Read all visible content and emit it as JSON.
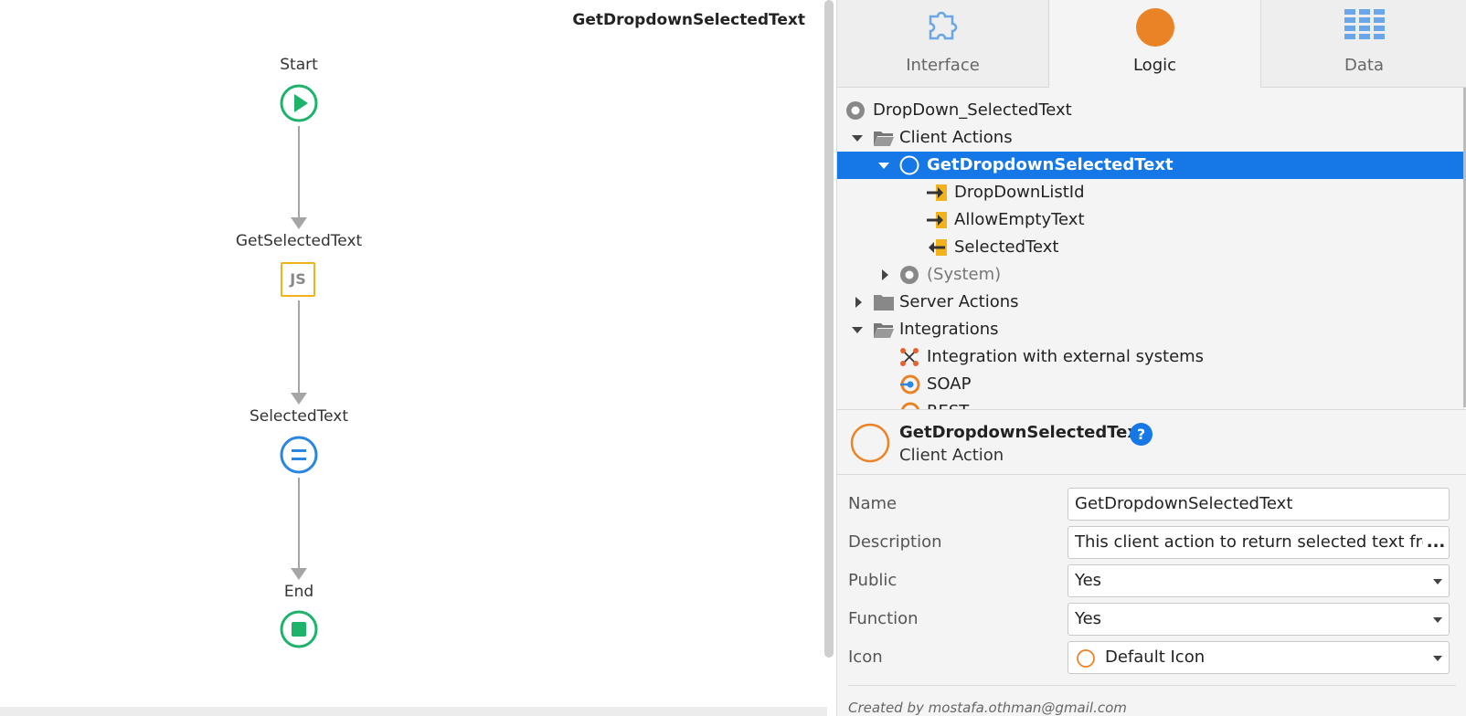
{
  "canvas": {
    "title": "GetDropdownSelectedText",
    "nodes": {
      "start_label": "Start",
      "js_label": "GetSelectedText",
      "js_icon_text": "JS",
      "assign_label": "SelectedText",
      "end_label": "End"
    }
  },
  "tabs": [
    {
      "label": "Interface",
      "icon": "puzzle-icon"
    },
    {
      "label": "Logic",
      "icon": "orange-circle-icon"
    },
    {
      "label": "Data",
      "icon": "table-grid-icon"
    }
  ],
  "tree": {
    "module": "DropDown_SelectedText",
    "client_actions": "Client Actions",
    "selected_action": "GetDropdownSelectedText",
    "param_1": "DropDownListId",
    "param_2": "AllowEmptyText",
    "output_param": "SelectedText",
    "system": "(System)",
    "server_actions": "Server Actions",
    "integrations": "Integrations",
    "integration_external": "Integration with external systems",
    "soap": "SOAP",
    "rest": "REST"
  },
  "properties": {
    "header_name": "GetDropdownSelectedText",
    "header_type": "Client Action",
    "help_glyph": "?",
    "name_label": "Name",
    "name_value": "GetDropdownSelectedText",
    "description_label": "Description",
    "description_value": "This client action to return selected text from a",
    "description_btn": "...",
    "public_label": "Public",
    "public_value": "Yes",
    "function_label": "Function",
    "function_value": "Yes",
    "icon_label": "Icon",
    "icon_value": "Default Icon",
    "created_by": "Created by mostafa.othman@gmail.com"
  },
  "colors": {
    "accent_blue": "#1677e6",
    "flow_green": "#1db36b",
    "js_yellow": "#f2b21b",
    "assign_blue": "#2a86e0",
    "logic_orange": "#ea8326"
  }
}
